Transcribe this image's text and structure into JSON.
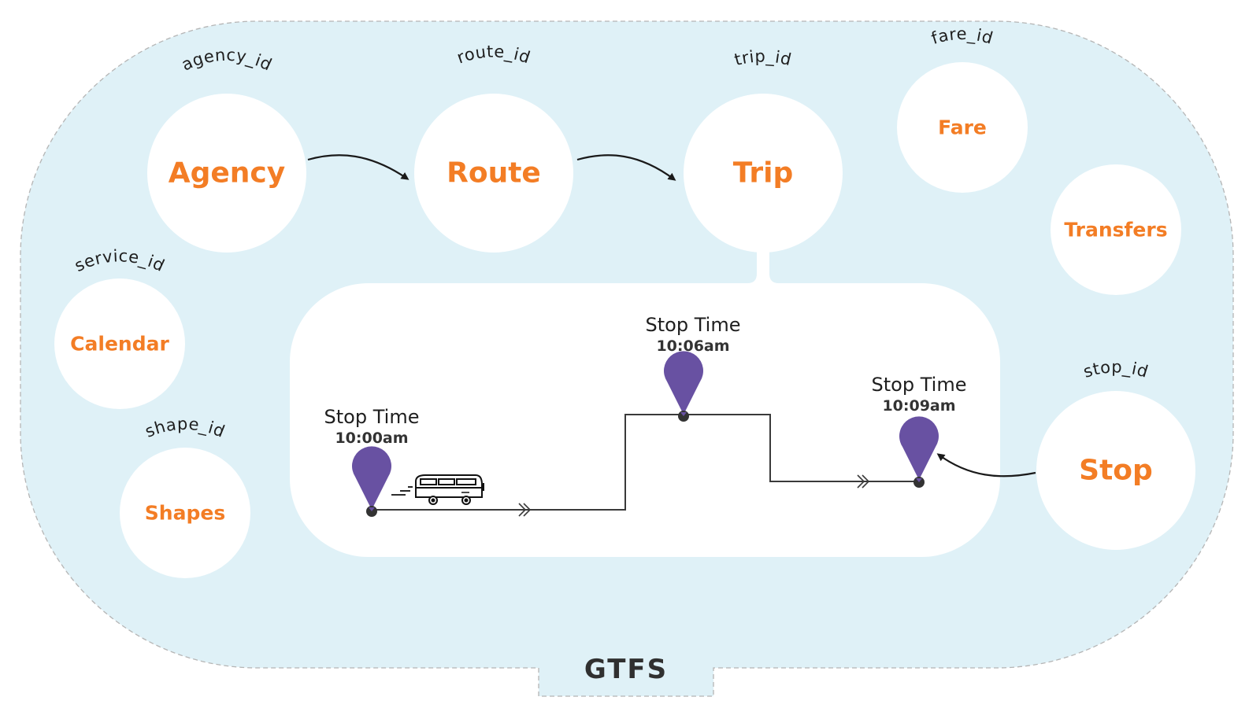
{
  "title": "GTFS",
  "colors": {
    "background": "#DFF1F7",
    "border": "#B5B5B5",
    "entity_text": "#F37D25",
    "pin": "#6851A2",
    "line": "#333333",
    "arrow": "#1a1a1a"
  },
  "entities": [
    {
      "id": "agency",
      "label": "Agency",
      "key": "agency_id"
    },
    {
      "id": "route",
      "label": "Route",
      "key": "route_id"
    },
    {
      "id": "trip",
      "label": "Trip",
      "key": "trip_id"
    },
    {
      "id": "fare",
      "label": "Fare",
      "key": "fare_id"
    },
    {
      "id": "transfers",
      "label": "Transfers",
      "key": ""
    },
    {
      "id": "calendar",
      "label": "Calendar",
      "key": "service_id"
    },
    {
      "id": "shapes",
      "label": "Shapes",
      "key": "shape_id"
    },
    {
      "id": "stop",
      "label": "Stop",
      "key": "stop_id"
    }
  ],
  "relations": [
    {
      "from": "agency",
      "to": "route"
    },
    {
      "from": "route",
      "to": "trip"
    },
    {
      "from": "stop",
      "to": "stop_time_3"
    }
  ],
  "stop_times": [
    {
      "id": "stop_time_1",
      "label": "Stop Time",
      "time": "10:00am"
    },
    {
      "id": "stop_time_2",
      "label": "Stop Time",
      "time": "10:06am"
    },
    {
      "id": "stop_time_3",
      "label": "Stop Time",
      "time": "10:09am"
    }
  ],
  "icons": {
    "vehicle": "bus-icon",
    "stop_marker": "map-pin-icon",
    "direction": "double-chevron-icon"
  }
}
